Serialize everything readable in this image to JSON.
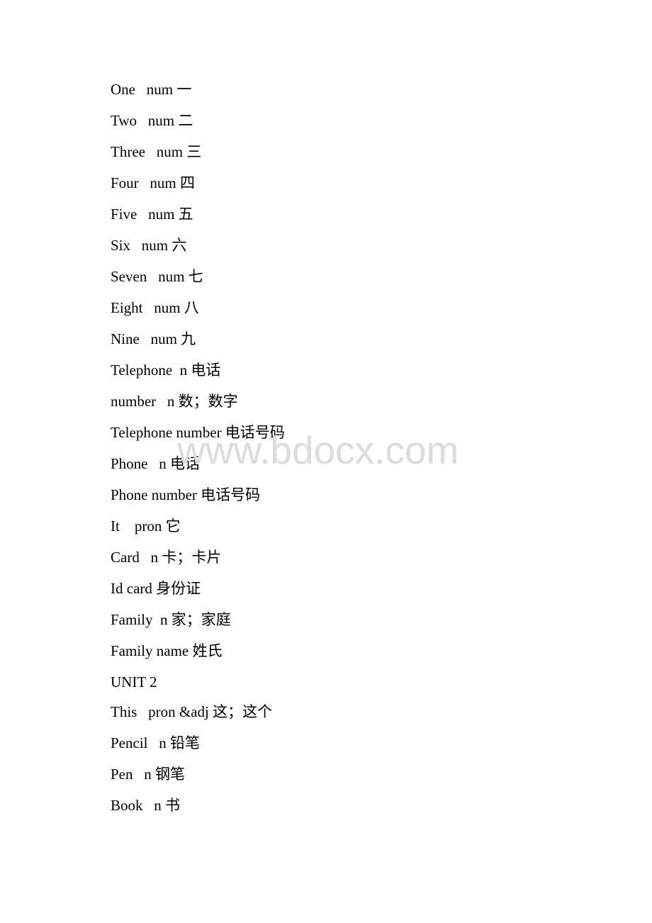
{
  "document": {
    "watermark": "www.bdocx.com",
    "entries": [
      {
        "text": "One   num 一"
      },
      {
        "text": "Two   num 二"
      },
      {
        "text": "Three   num 三"
      },
      {
        "text": "Four   num 四"
      },
      {
        "text": "Five   num 五"
      },
      {
        "text": "Six   num 六"
      },
      {
        "text": "Seven   num 七"
      },
      {
        "text": "Eight   num 八"
      },
      {
        "text": "Nine   num 九"
      },
      {
        "text": "Telephone  n 电话"
      },
      {
        "text": "number   n 数；数字"
      },
      {
        "text": "Telephone number 电话号码"
      },
      {
        "text": "Phone   n 电话"
      },
      {
        "text": "Phone number 电话号码"
      },
      {
        "text": "It    pron 它"
      },
      {
        "text": "Card   n 卡；卡片"
      },
      {
        "text": "Id card 身份证"
      },
      {
        "text": "Family  n 家；家庭"
      },
      {
        "text": "Family name 姓氏"
      },
      {
        "text": "UNIT 2"
      },
      {
        "text": "This   pron &adj 这；这个"
      },
      {
        "text": "Pencil   n 铅笔"
      },
      {
        "text": "Pen   n 钢笔"
      },
      {
        "text": "Book   n 书"
      }
    ]
  }
}
